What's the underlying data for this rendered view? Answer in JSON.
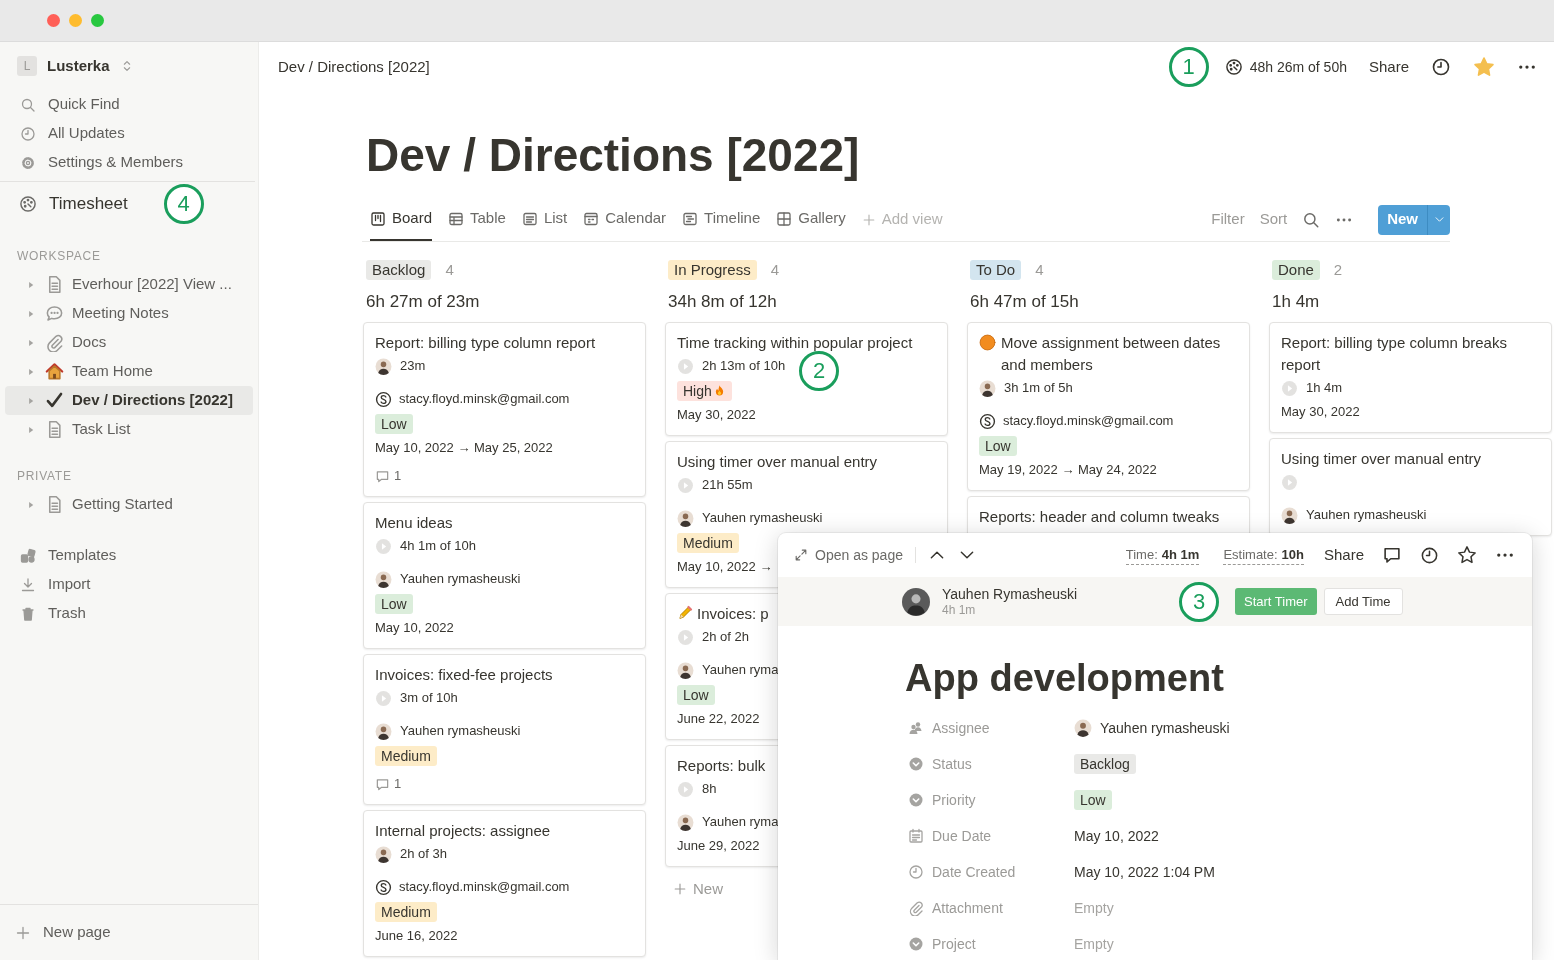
{
  "sidebar": {
    "workspace": "Lusterka",
    "workspace_initial": "L",
    "nav": [
      {
        "label": "Quick Find"
      },
      {
        "label": "All Updates"
      },
      {
        "label": "Settings & Members"
      }
    ],
    "timesheet": {
      "label": "Timesheet",
      "callout": "4"
    },
    "sections": [
      {
        "title": "WORKSPACE",
        "pages": [
          {
            "label": "Everhour [2022] View ...",
            "selected": false,
            "expanded": false
          },
          {
            "label": "Meeting Notes",
            "selected": false,
            "expanded": false
          },
          {
            "label": "Docs",
            "selected": false,
            "expanded": false
          },
          {
            "label": "Team Home",
            "selected": false,
            "expanded": false
          },
          {
            "label": "Dev / Directions [2022]",
            "selected": true,
            "expanded": false
          },
          {
            "label": "Task List",
            "selected": false,
            "expanded": false
          }
        ]
      },
      {
        "title": "PRIVATE",
        "pages": [
          {
            "label": "Getting Started",
            "selected": false,
            "expanded": false
          }
        ]
      }
    ],
    "tools": [
      {
        "label": "Templates"
      },
      {
        "label": "Import"
      },
      {
        "label": "Trash"
      }
    ],
    "new_page": "New page"
  },
  "topbar": {
    "breadcrumb": "Dev / Directions [2022]",
    "callout": "1",
    "timer": "48h 26m of 50h",
    "share": "Share",
    "favorite": true
  },
  "title": "Dev / Directions [2022]",
  "views": [
    {
      "label": "Board",
      "selected": true
    },
    {
      "label": "Table",
      "selected": false
    },
    {
      "label": "List",
      "selected": false
    },
    {
      "label": "Calendar",
      "selected": false
    },
    {
      "label": "Timeline",
      "selected": false
    },
    {
      "label": "Gallery",
      "selected": false
    }
  ],
  "add_view": "Add view",
  "actions": {
    "filter": "Filter",
    "sort": "Sort",
    "new": "New"
  },
  "board": {
    "columns": [
      {
        "status": "Backlog",
        "color": "#e9e9e7",
        "count": "4",
        "total": "6h 27m of 23m",
        "cards": [
          {
            "kind": "plain",
            "title": "Report: billing type column report",
            "lines": [
              {
                "kind": "owner-time",
                "text": "23m"
              },
              {
                "kind": "email",
                "text": "stacy.floyd.minsk@gmail.com"
              },
              {
                "kind": "tag",
                "text": "Low",
                "color": "#dbeddb"
              },
              {
                "kind": "date",
                "text": "May 10, 2022 → May 25, 2022"
              },
              {
                "kind": "comments",
                "text": "1"
              }
            ]
          },
          {
            "kind": "plain",
            "title": "Menu ideas",
            "lines": [
              {
                "kind": "timer",
                "text": "4h 1m of 10h"
              },
              {
                "kind": "person",
                "text": "Yauhen rymasheuski"
              },
              {
                "kind": "tag",
                "text": "Low",
                "color": "#dbeddb"
              },
              {
                "kind": "date",
                "text": "May 10, 2022"
              }
            ]
          },
          {
            "kind": "plain",
            "title": "Invoices: fixed-fee projects",
            "lines": [
              {
                "kind": "timer",
                "text": "3m of 10h"
              },
              {
                "kind": "person",
                "text": "Yauhen rymasheuski"
              },
              {
                "kind": "tag",
                "text": "Medium",
                "color": "#fdecc8"
              },
              {
                "kind": "comments",
                "text": "1"
              }
            ]
          },
          {
            "kind": "plain",
            "title": "Internal projects: assignee",
            "lines": [
              {
                "kind": "owner-time",
                "text": "2h of 3h"
              },
              {
                "kind": "email",
                "text": "stacy.floyd.minsk@gmail.com"
              },
              {
                "kind": "tag",
                "text": "Medium",
                "color": "#fdecc8"
              },
              {
                "kind": "date",
                "text": "June 16, 2022"
              }
            ]
          }
        ]
      },
      {
        "status": "In Progress",
        "color": "#fdecc8",
        "count": "4",
        "total": "34h 8m of 12h",
        "add_new": "New",
        "cards": [
          {
            "kind": "plain",
            "title": "Time tracking within popular project",
            "lines": [
              {
                "kind": "timer",
                "text": "2h 13m of 10h",
                "callout": "2"
              },
              {
                "kind": "tag",
                "text": "High",
                "color": "#fde2dd",
                "flame": true
              },
              {
                "kind": "date",
                "text": "May 30, 2022"
              }
            ]
          },
          {
            "kind": "plain",
            "title": "Using timer over manual entry",
            "lines": [
              {
                "kind": "timer",
                "text": "21h 55m"
              },
              {
                "kind": "person",
                "text": "Yauhen rymasheuski"
              },
              {
                "kind": "tag",
                "text": "Medium",
                "color": "#fdecc8"
              },
              {
                "kind": "date",
                "text": "May 10, 2022 →"
              }
            ]
          },
          {
            "kind": "pencil",
            "title": "Invoices: p",
            "lines": [
              {
                "kind": "timer",
                "text": "2h of 2h"
              },
              {
                "kind": "person",
                "text": "Yauhen ryma"
              },
              {
                "kind": "tag",
                "text": "Low",
                "color": "#dbeddb"
              },
              {
                "kind": "date",
                "text": "June 22, 2022"
              }
            ]
          },
          {
            "kind": "plain",
            "title": "Reports: bulk",
            "lines": [
              {
                "kind": "timer",
                "text": "8h"
              },
              {
                "kind": "person",
                "text": "Yauhen ryma"
              },
              {
                "kind": "date",
                "text": "June 29, 2022"
              }
            ]
          }
        ]
      },
      {
        "status": "To Do",
        "color": "#d3e5ef",
        "count": "4",
        "total": "6h 47m of 15h",
        "cards": [
          {
            "kind": "dot",
            "title": "Move assignment between dates and members",
            "lines": [
              {
                "kind": "owner-time",
                "text": "3h 1m of 5h"
              },
              {
                "kind": "email",
                "text": "stacy.floyd.minsk@gmail.com"
              },
              {
                "kind": "tag",
                "text": "Low",
                "color": "#dbeddb"
              },
              {
                "kind": "date",
                "text": "May 19, 2022 → May 24, 2022"
              }
            ]
          },
          {
            "kind": "plain",
            "title": "Reports: header and column tweaks"
          }
        ]
      },
      {
        "status": "Done",
        "color": "#dbeddb",
        "count": "2",
        "total": "1h 4m",
        "cards": [
          {
            "kind": "plain",
            "title": "Report: billing type column breaks report",
            "lines": [
              {
                "kind": "timer",
                "text": "1h 4m"
              },
              {
                "kind": "date",
                "text": "May 30, 2022"
              }
            ]
          },
          {
            "kind": "plain",
            "title": "Using timer over manual entry",
            "lines": [
              {
                "kind": "timer"
              },
              {
                "kind": "person",
                "text": "Yauhen rymasheuski"
              }
            ]
          }
        ]
      }
    ]
  },
  "popup": {
    "open_as_page": "Open as page",
    "time_label": "Time:",
    "time": "4h 1m",
    "estimate_label": "Estimate:",
    "estimate": "10h",
    "share": "Share",
    "favorite": false,
    "user": "Yauhen Rymasheuski",
    "user_time": "4h 1m",
    "callout": "3",
    "start": "Start Timer",
    "add": "Add Time",
    "title": "App development",
    "properties": [
      {
        "label": "Assignee",
        "kind": "person",
        "value": "Yauhen rymasheuski"
      },
      {
        "label": "Status",
        "kind": "tag",
        "value": "Backlog",
        "color": "#e9e9e7"
      },
      {
        "label": "Priority",
        "kind": "tag",
        "value": "Low",
        "color": "#dbeddb"
      },
      {
        "label": "Due Date",
        "kind": "text",
        "value": "May 10, 2022"
      },
      {
        "label": "Date Created",
        "kind": "text",
        "value": "May 10, 2022 1:04 PM"
      },
      {
        "label": "Attachment",
        "kind": "empty",
        "value": "Empty"
      },
      {
        "label": "Project",
        "kind": "empty",
        "value": "Empty"
      }
    ]
  }
}
